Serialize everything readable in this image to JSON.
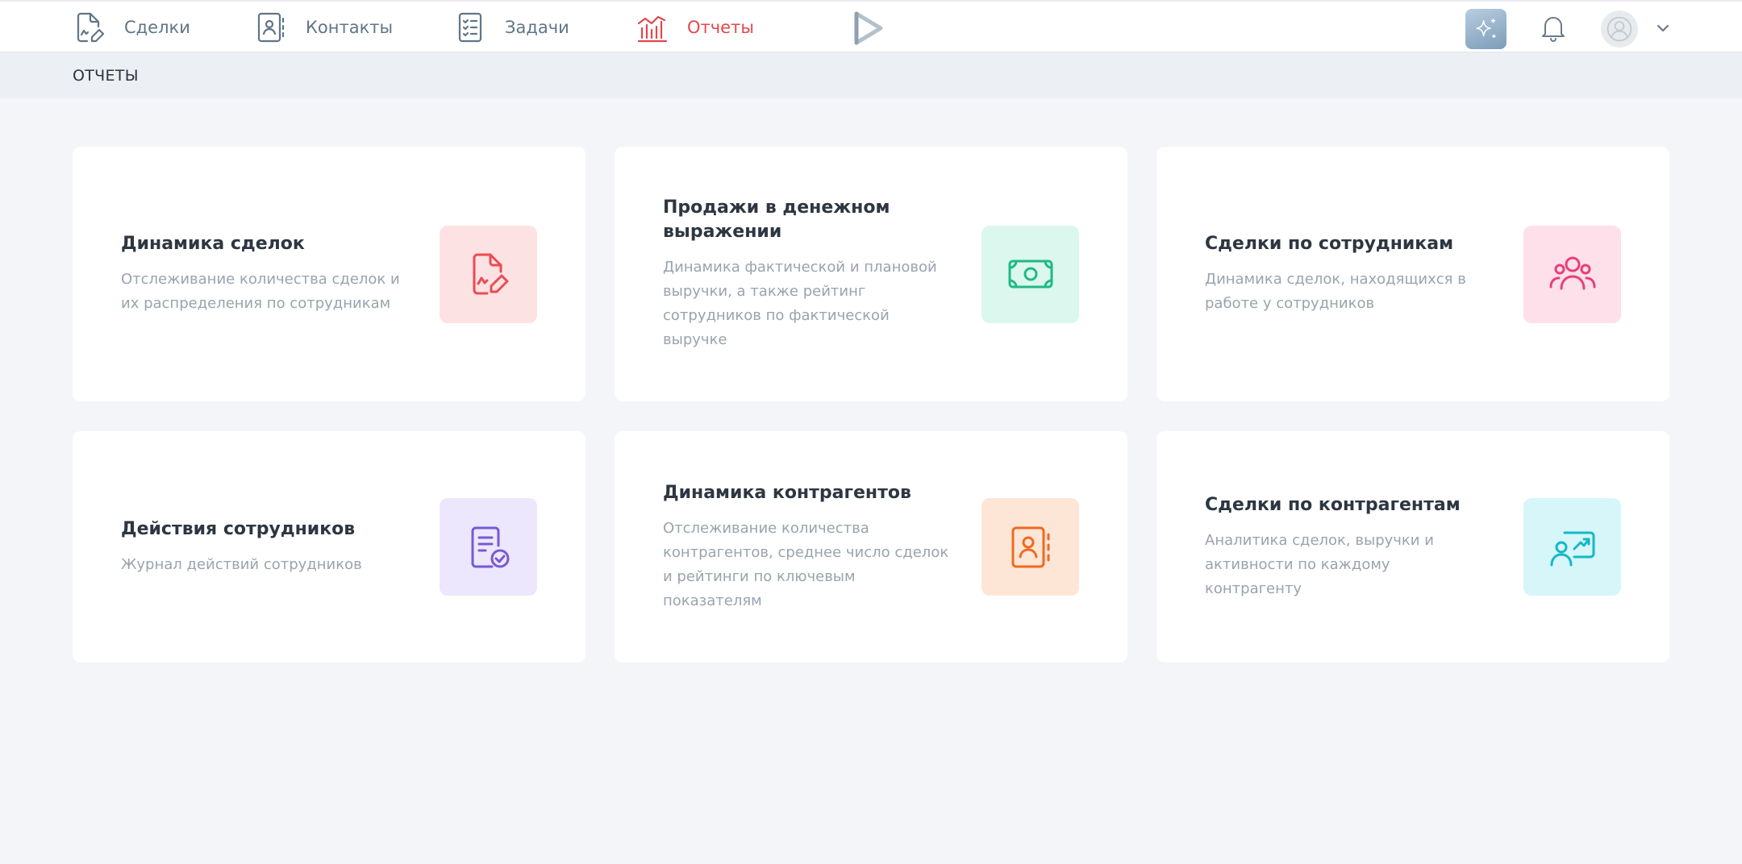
{
  "nav": {
    "items": [
      {
        "label": "Сделки",
        "icon": "deal-document-icon"
      },
      {
        "label": "Контакты",
        "icon": "contact-book-icon"
      },
      {
        "label": "Задачи",
        "icon": "checklist-icon"
      },
      {
        "label": "Отчеты",
        "icon": "chart-icon",
        "active": true
      }
    ]
  },
  "page": {
    "title": "ОТЧЕТЫ"
  },
  "reports": [
    {
      "title": "Динамика сделок",
      "description": "Отслеживание количества сделок и их распределения по сотрудникам",
      "icon": "document-signature-icon",
      "icon_color": "#ea4c52",
      "icon_bg": "#fde2e3"
    },
    {
      "title": "Продажи в денежном выражении",
      "description": "Динамика фактической и плановой выручки, а также рейтинг сотрудников по фактической выручке",
      "icon": "banknote-icon",
      "icon_color": "#1fba85",
      "icon_bg": "#dcf7ee"
    },
    {
      "title": "Сделки по сотрудникам",
      "description": "Динамика сделок, находящихся в работе у сотрудников",
      "icon": "users-icon",
      "icon_color": "#e83f79",
      "icon_bg": "#fde0ea"
    },
    {
      "title": "Действия сотрудников",
      "description": "Журнал действий сотрудников",
      "icon": "document-check-icon",
      "icon_color": "#7858d4",
      "icon_bg": "#ece7fc"
    },
    {
      "title": "Динамика контрагентов",
      "description": "Отслеживание количества контрагентов, среднее число сделок и рейтинги по ключевым показателям",
      "icon": "contact-book-icon",
      "icon_color": "#ee6a1f",
      "icon_bg": "#fee6d7"
    },
    {
      "title": "Сделки по контрагентам",
      "description": "Аналитика сделок, выручки и активности по каждому контрагенту",
      "icon": "presentation-user-icon",
      "icon_color": "#14b8c7",
      "icon_bg": "#d6f6fa"
    }
  ]
}
